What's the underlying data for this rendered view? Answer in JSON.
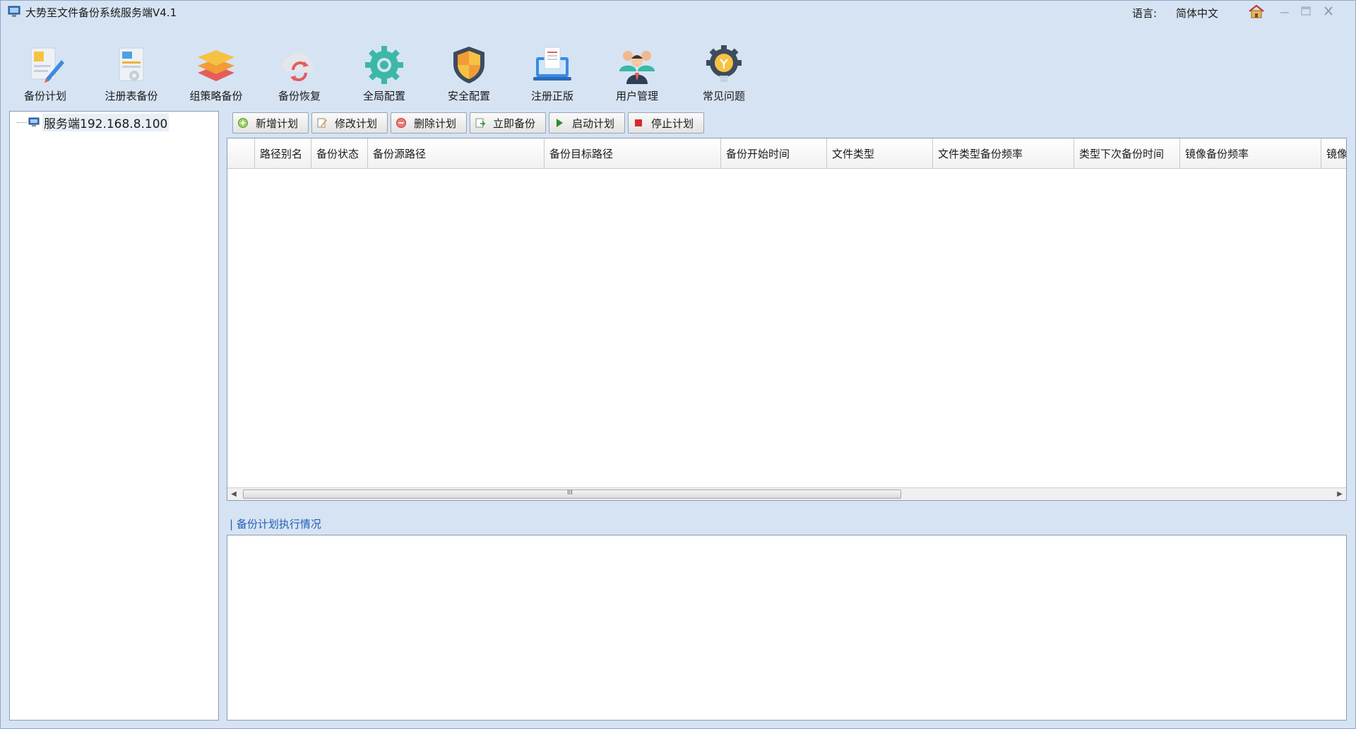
{
  "window": {
    "title": "大势至文件备份系统服务端V4.1",
    "language_label": "语言:",
    "language_value": "简体中文"
  },
  "toolbar": [
    {
      "label": "备份计划",
      "icon": "backup-plan-icon"
    },
    {
      "label": "注册表备份",
      "icon": "registry-backup-icon"
    },
    {
      "label": "组策略备份",
      "icon": "group-policy-backup-icon"
    },
    {
      "label": "备份恢复",
      "icon": "backup-restore-icon"
    },
    {
      "label": "全局配置",
      "icon": "gear-icon"
    },
    {
      "label": "安全配置",
      "icon": "shield-icon"
    },
    {
      "label": "注册正版",
      "icon": "register-icon"
    },
    {
      "label": "用户管理",
      "icon": "users-icon"
    },
    {
      "label": "常见问题",
      "icon": "lightbulb-icon"
    }
  ],
  "tree": {
    "root_label": "服务端192.168.8.100"
  },
  "actions": [
    {
      "label": "新增计划",
      "icon": "add-icon"
    },
    {
      "label": "修改计划",
      "icon": "edit-icon"
    },
    {
      "label": "删除计划",
      "icon": "delete-icon"
    },
    {
      "label": "立即备份",
      "icon": "backup-now-icon"
    },
    {
      "label": "启动计划",
      "icon": "play-icon"
    },
    {
      "label": "停止计划",
      "icon": "stop-icon"
    }
  ],
  "grid": {
    "columns": [
      "",
      "路径别名",
      "备份状态",
      "备份源路径",
      "备份目标路径",
      "备份开始时间",
      "文件类型",
      "文件类型备份频率",
      "类型下次备份时间",
      "镜像备份频率",
      "镜像"
    ],
    "rows": [],
    "scroll_grip": "III"
  },
  "log": {
    "title": "| 备份计划执行情况"
  },
  "colors": {
    "background": "#d6e3f3",
    "log_title": "#1f5fb4"
  }
}
